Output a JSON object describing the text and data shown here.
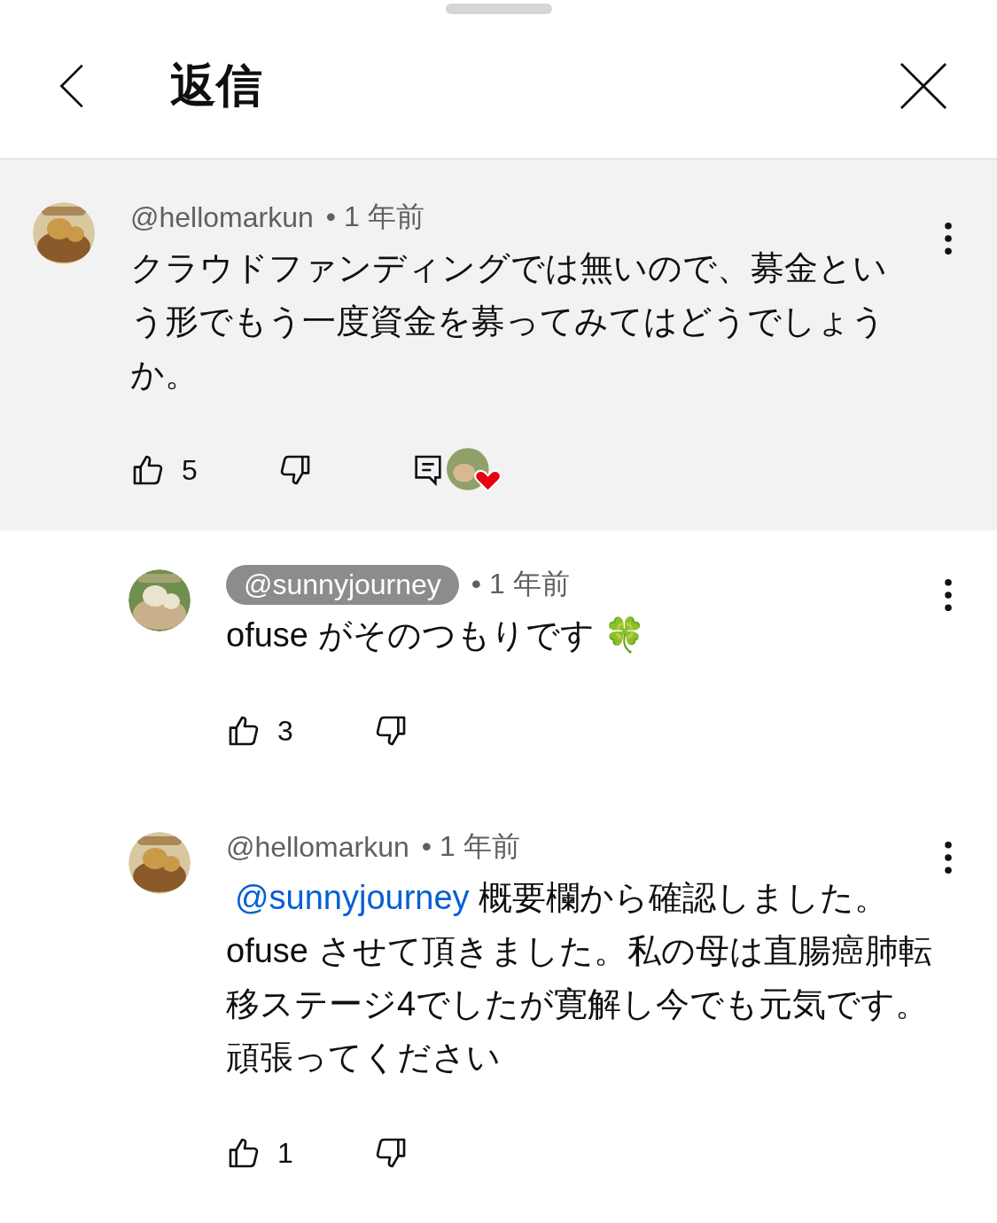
{
  "header": {
    "title": "返信"
  },
  "comments": [
    {
      "kind": "top",
      "author": "@hellomarkun",
      "author_badge": false,
      "time": "• 1 年前",
      "text": "クラウドファンディングでは無いので、募金という形でもう一度資金を募ってみてはどうでしょうか。",
      "likes": "5",
      "creator_heart": true
    },
    {
      "kind": "reply",
      "author": "@sunnyjourney",
      "author_badge": true,
      "time": "• 1 年前",
      "text": "ofuse がそのつもりです 🍀",
      "likes": "3",
      "creator_heart": false
    },
    {
      "kind": "reply",
      "author": "@hellomarkun",
      "author_badge": false,
      "time": "• 1 年前",
      "mention": "@sunnyjourney",
      "text": "概要欄から確認しました。ofuse させて頂きました。私の母は直腸癌肺転移ステージ4でしたが寛解し今でも元気です。頑張ってください",
      "likes": "1",
      "creator_heart": false
    }
  ]
}
